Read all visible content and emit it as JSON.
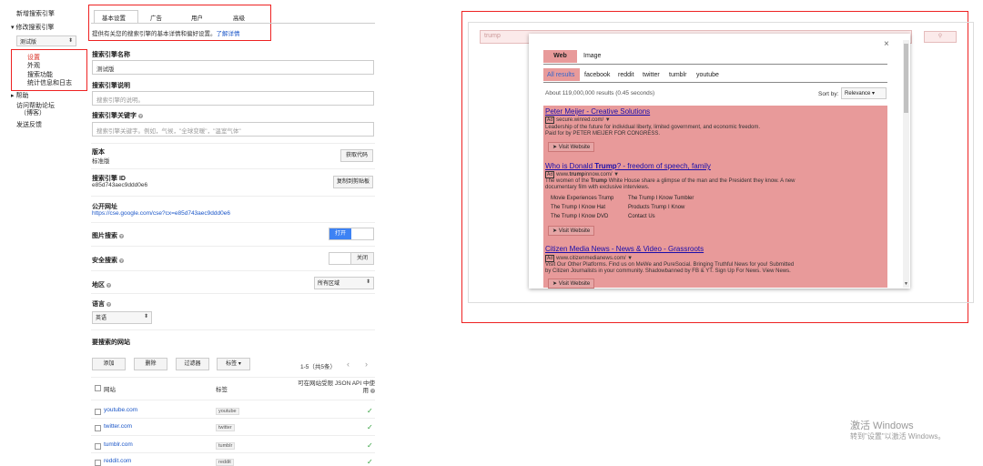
{
  "sidebar": {
    "new_engine": "新增搜索引擎",
    "edit_engine": "▾ 修改搜索引擎",
    "engine_select": "测试版",
    "items": [
      "设置",
      "外观",
      "搜索功能",
      "统计信息和日志"
    ],
    "help": "▸ 帮助",
    "forum": "访问帮助论坛",
    "forum_sub": "（博客）",
    "feedback": "发送反馈"
  },
  "tabs": [
    "基本设置",
    "广告",
    "用户",
    "高级"
  ],
  "intro": {
    "text": "提供有关您的搜索引擎的基本详情和偏好设置。",
    "link": "了解详情"
  },
  "form": {
    "name_label": "搜索引擎名称",
    "name_value": "测试版",
    "desc_label": "搜索引擎说明",
    "desc_placeholder": "搜索引擎的说明。",
    "keywords_label": "搜索引擎关键字",
    "keywords_placeholder": "搜索引擎关键字。例如，气候，\"全球变暖\"，\"温室气体\"",
    "edition_label": "版本",
    "edition_value": "标准版",
    "get_code_btn": "获取代码",
    "id_label": "搜索引擎 ID",
    "id_value": "e85d743aec9ddd0e6",
    "copy_btn": "复制到剪贴板",
    "public_url_label": "公开网址",
    "public_url": "https://cse.google.com/cse?cx=e85d743aec9ddd0e6",
    "image_search_label": "图片搜索",
    "image_toggle_on": "打开",
    "safe_search_label": "安全搜索",
    "safe_toggle_off": "关闭",
    "region_label": "地区",
    "region_value": "所有区域",
    "language_label": "语言",
    "language_value": "英语",
    "sites_label": "要搜索的网站",
    "add_btn": "添加",
    "delete_btn": "删除",
    "filter_btn": "过滤器",
    "tag_btn": "标签",
    "pagination": "1-5（共5条）",
    "col_site": "网站",
    "col_tag": "标签",
    "col_json": "可在网站受限 JSON API 中使用",
    "sites": [
      {
        "site": "youtube.com",
        "tag": "youtube"
      },
      {
        "site": "twitter.com",
        "tag": "twitter"
      },
      {
        "site": "tumblr.com",
        "tag": "tumblr"
      },
      {
        "site": "reddit.com",
        "tag": "reddit"
      }
    ],
    "checkmark": "✓"
  },
  "preview": {
    "search_value": "trump",
    "close": "×",
    "tab_web": "Web",
    "tab_image": "Image",
    "filters": [
      "All results",
      "facebook",
      "reddit",
      "twitter",
      "tumblr",
      "youtube"
    ],
    "about": "About 119,000,000 results (0.45 seconds)",
    "sort_label": "Sort by:",
    "sort_value": "Relevance",
    "ad_badge": "Ad",
    "visit_btn": "➤ Visit Website",
    "results": [
      {
        "title": "Peter Meijer - Creative Solutions",
        "url": "secure.winred.com/ ▼",
        "desc1": "Leadership of the future for individual liberty, limited government, and economic freedom.",
        "desc2": "Paid for by PETER MEIJER FOR CONGRESS."
      },
      {
        "title_pre": "Who is Donald ",
        "title_bold": "Trump",
        "title_post": "? - freedom of speech, family",
        "url_pre": "www.",
        "url_bold": "trump",
        "url_post": "innow.com/ ▼",
        "desc1_pre": "The women of the ",
        "desc1_bold": "Trump",
        "desc1_post": " White House share a glimpse of the man and the President they know. A new",
        "desc2": "documentary film with exclusive interviews.",
        "sublinks": [
          "Movie Experiences Trump",
          "The Trump I Know Tumbler",
          "The Trump I Know Hat",
          "Products Trump I Know",
          "The Trump I Know DVD",
          "Contact Us"
        ]
      },
      {
        "title": "Citizen Media News - News & Video - Grassroots",
        "url": "www.citizenmedianews.com/ ▼",
        "desc1": "Visit Our Other Platforms. Find us on MeWe and PureSocial. Bringing Truthful News for you! Submitted",
        "desc2": "by Citizen Journalists in your community. Shadowbanned by FB & YT. Sign Up For News. View News."
      }
    ]
  },
  "watermark": {
    "title": "激活 Windows",
    "sub": "转到\"设置\"以激活 Windows。"
  },
  "colors": {
    "red_border": "#ee2222",
    "link": "#1a56c8",
    "toggle_on": "#3d82f4",
    "result_bg": "#e89a9a"
  }
}
